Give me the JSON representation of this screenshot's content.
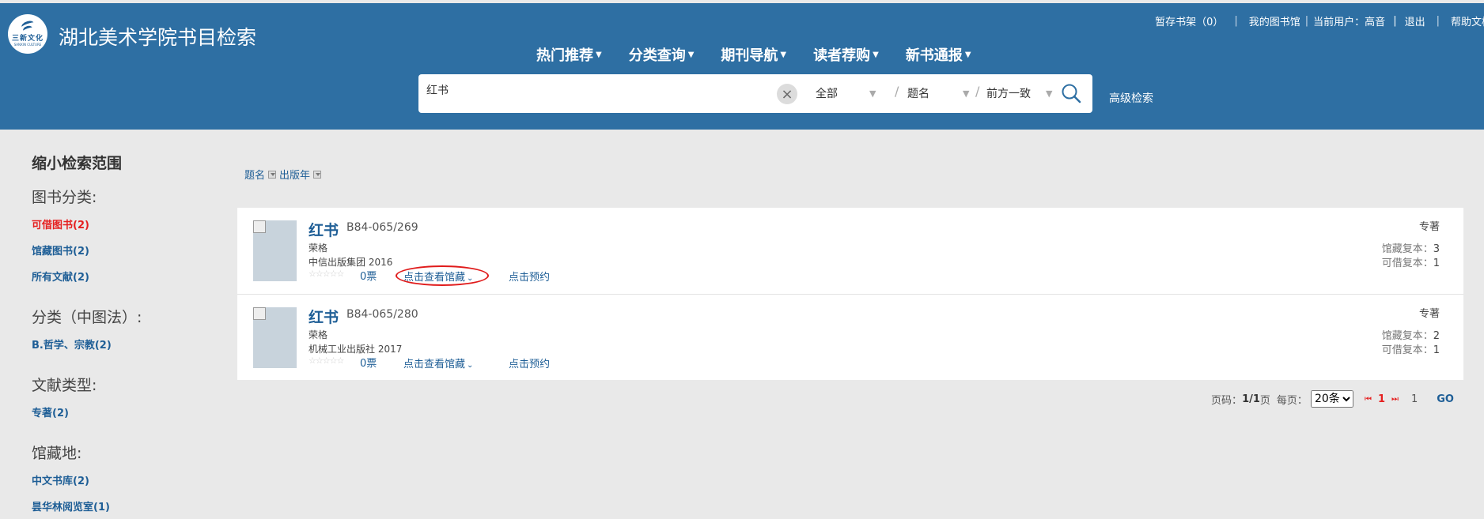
{
  "header": {
    "logo_text": "三新文化",
    "logo_sub": "SANXIN CULTURE",
    "title": "湖北美术学院书目检索",
    "top_links": {
      "shelf": "暂存书架（0）",
      "my_library": "我的图书馆",
      "current_user_label": "当前用户：",
      "current_user": "高音",
      "logout": "退出",
      "help": "帮助文档"
    },
    "nav": [
      "热门推荐",
      "分类查询",
      "期刊导航",
      "读者荐购",
      "新书通报"
    ],
    "search": {
      "query": "红书",
      "scope": "全部",
      "field": "题名",
      "match": "前方一致",
      "advanced": "高级检索"
    }
  },
  "sidebar": {
    "title": "缩小检索范围",
    "groups": [
      {
        "label": "图书分类:",
        "items": [
          "可借图书(2)",
          "馆藏图书(2)",
          "所有文献(2)"
        ]
      },
      {
        "label": "分类（中图法）:",
        "items": [
          "B.哲学、宗教(2)"
        ]
      },
      {
        "label": "文献类型:",
        "items": [
          "专著(2)"
        ]
      },
      {
        "label": "馆藏地:",
        "items": [
          "中文书库(2)",
          "昙华林阅览室(1)"
        ]
      }
    ]
  },
  "sort": {
    "by_title": "题名",
    "by_year": "出版年"
  },
  "results": [
    {
      "title": "红书",
      "call_number": "B84-065/269",
      "author": "荣格",
      "publisher_year": "中信出版集团  2016",
      "votes": "0票",
      "view_holdings": "点击查看馆藏",
      "reserve": "点击预约",
      "type": "专著",
      "holdings_label": "馆藏复本：",
      "holdings_count": "3",
      "available_label": "可借复本：",
      "available_count": "1"
    },
    {
      "title": "红书",
      "call_number": "B84-065/280",
      "author": "荣格",
      "publisher_year": "机械工业出版社  2017",
      "votes": "0票",
      "view_holdings": "点击查看馆藏",
      "reserve": "点击预约",
      "type": "专著",
      "holdings_label": "馆藏复本：",
      "holdings_count": "2",
      "available_label": "可借复本：",
      "available_count": "1"
    }
  ],
  "pager": {
    "page_label": "页码：",
    "page_value": "1/1",
    "page_suffix": "页",
    "per_page_label": "每页：",
    "per_page": "20条",
    "current": "1",
    "total": "1",
    "go": "GO"
  }
}
